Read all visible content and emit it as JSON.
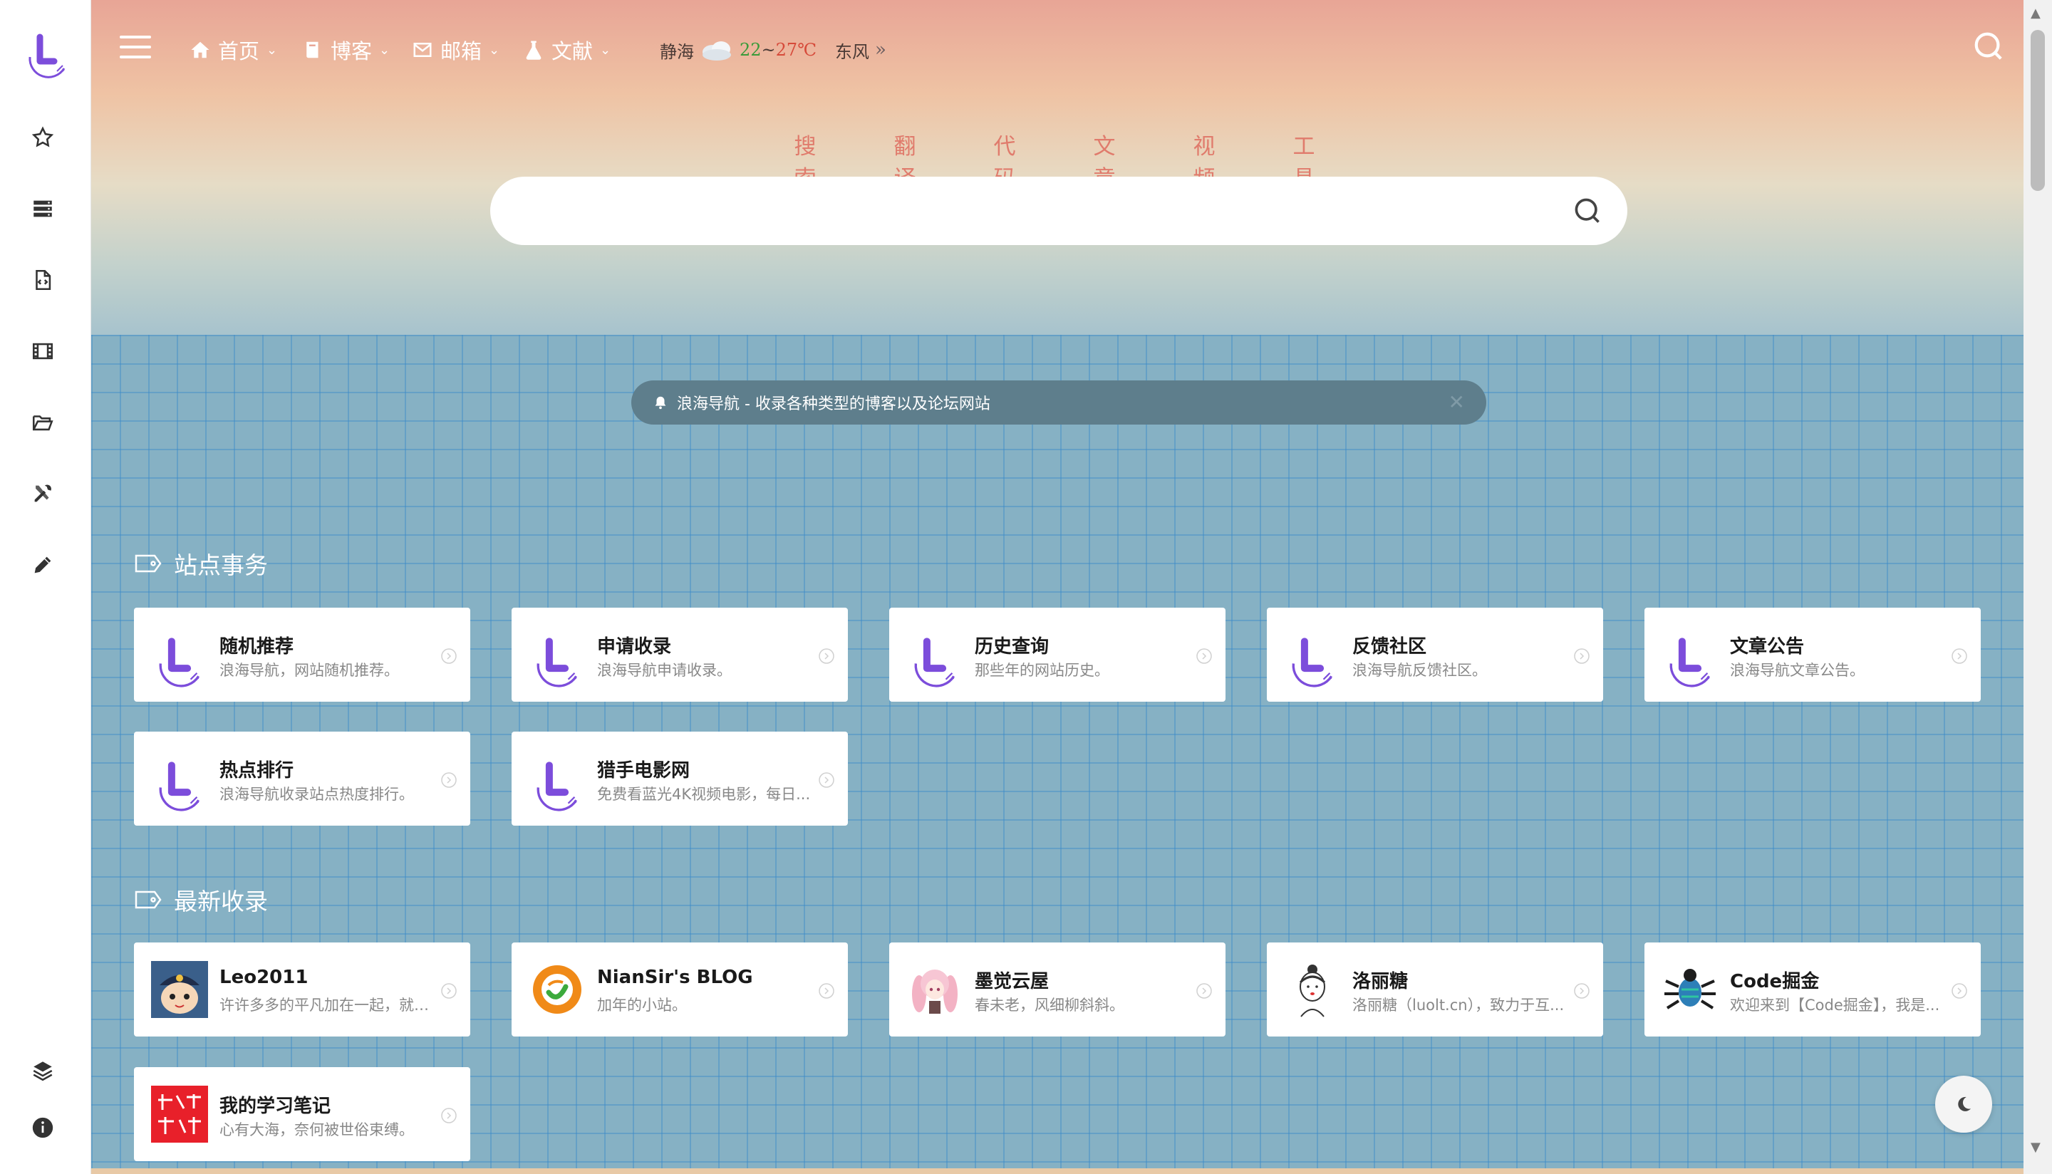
{
  "topnav": {
    "home": "首页",
    "blog": "博客",
    "mail": "邮箱",
    "docs": "文献"
  },
  "weather": {
    "city": "静海",
    "temp_low": "22",
    "sep": "~",
    "temp_high": "27℃",
    "wind": "东风",
    "icon": "cloud-icon"
  },
  "search": {
    "tabs": [
      "搜索",
      "翻译",
      "代码",
      "文章",
      "视频",
      "工具"
    ],
    "placeholder": ""
  },
  "notice": {
    "text": "浪海导航 - 收录各种类型的博客以及论坛网站"
  },
  "sections": {
    "site": {
      "title": "站点事务",
      "cards": [
        {
          "title": "随机推荐",
          "desc": "浪海导航，网站随机推荐。"
        },
        {
          "title": "申请收录",
          "desc": "浪海导航申请收录。"
        },
        {
          "title": "历史查询",
          "desc": "那些年的网站历史。"
        },
        {
          "title": "反馈社区",
          "desc": "浪海导航反馈社区。"
        },
        {
          "title": "文章公告",
          "desc": "浪海导航文章公告。"
        },
        {
          "title": "热点排行",
          "desc": "浪海导航收录站点热度排行。"
        },
        {
          "title": "猎手电影网",
          "desc": "免费看蓝光4K视频电影，每日..."
        }
      ]
    },
    "latest": {
      "title": "最新收录",
      "cards": [
        {
          "title": "Leo2011",
          "desc": "许许多多的平凡加在一起，就成..."
        },
        {
          "title": "NianSir's BLOG",
          "desc": "加年的小站。"
        },
        {
          "title": "墨觉云屋",
          "desc": "春未老，风细柳斜斜。"
        },
        {
          "title": "洛丽糖",
          "desc": "洛丽糖（luolt.cn），致力于互..."
        },
        {
          "title": "Code掘金",
          "desc": "欢迎来到【Code掘金】，我是..."
        },
        {
          "title": "我的学习笔记",
          "desc": "心有大海，奈何被世俗束缚。"
        }
      ]
    }
  },
  "colors": {
    "accent": "#7c4ddb",
    "tab_text": "#e07b6c",
    "grid_bg": "#86b1c4"
  }
}
